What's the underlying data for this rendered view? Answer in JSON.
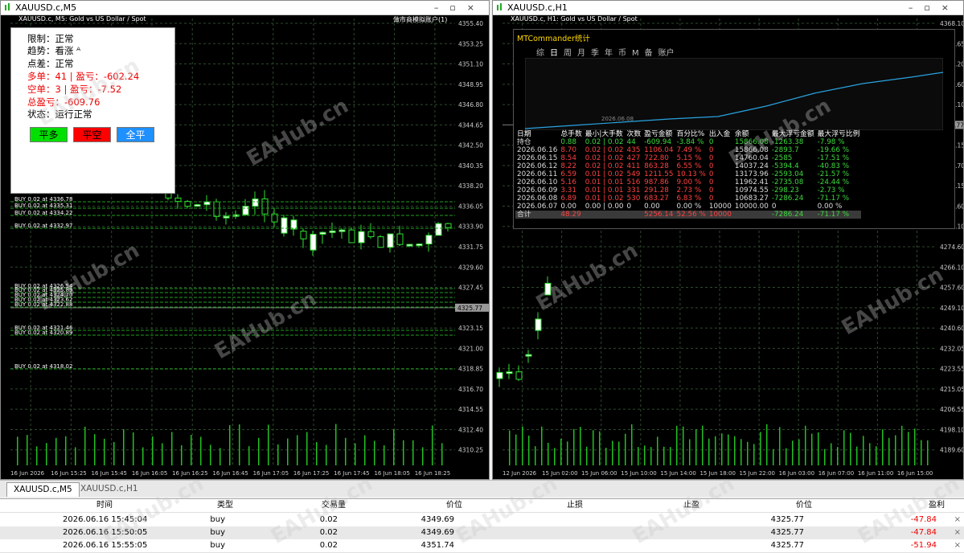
{
  "left_window": {
    "title": "XAUUSD.c,M5",
    "subtitle": "XAUUSD.c, M5: Gold vs US Dollar / Spot",
    "top_right": "做市商模拟账户(1)",
    "prices": [
      "4355.40",
      "4353.25",
      "4351.10",
      "4348.95",
      "4346.80",
      "4344.65",
      "4342.50",
      "4340.35",
      "4338.20",
      "4336.05",
      "4333.90",
      "4331.75",
      "4329.60",
      "4327.45",
      "4325.30",
      "4323.15",
      "4321.00",
      "4318.85",
      "4316.70",
      "4314.55",
      "4312.40",
      "4310.25"
    ],
    "current_price": "4325.77",
    "times": [
      "16 Jun 2026",
      "16 Jun 15:25",
      "16 Jun 15:45",
      "16 Jun 16:05",
      "16 Jun 16:25",
      "16 Jun 16:45",
      "16 Jun 17:05",
      "16 Jun 17:25",
      "16 Jun 17:45",
      "16 Jun 18:05",
      "16 Jun 18:25"
    ],
    "buy_labels": [
      "BUY 0.02 at 4336.78",
      "BUY 0.02 at 4335.31",
      "BUY 0.02 at 4334.22",
      "BUY 0.02 at 4332.97",
      "BUY 0.02 at 4326.54",
      "BUY 0.02 at 4325.89",
      "BUY 0.02 at 4324.70",
      "BUY 0.02 at 4323.62",
      "BUY 0.02 at 4322.88",
      "BUY 0.02 at 4321.46",
      "BUY 0.02 at 4320.89",
      "BUY 0.02 at 4318.02"
    ]
  },
  "right_window": {
    "title": "XAUUSD.c,H1",
    "subtitle": "XAUUSD.c, H1: Gold vs US Dollar / Spot",
    "prices": [
      "4368.10",
      "4359.65",
      "4351.20",
      "4342.60",
      "4334.10",
      "4325.77",
      "4317.15",
      "4308.70",
      "4300.15",
      "4291.60",
      "4283.10",
      "4274.60",
      "4266.10",
      "4257.60",
      "4249.10",
      "4240.60",
      "4232.05",
      "4223.55",
      "4215.05",
      "4206.55",
      "4198.10",
      "4189.60"
    ],
    "times": [
      "12 Jun 2026",
      "15 Jun 02:00",
      "15 Jun 06:00",
      "15 Jun 10:00",
      "15 Jun 14:00",
      "15 Jun 18:00",
      "15 Jun 22:00",
      "16 Jun 03:00",
      "16 Jun 07:00",
      "16 Jun 11:00",
      "16 Jun 15:00"
    ]
  },
  "panel": {
    "limit": "限制：正常",
    "trend": "趋势：看涨 ᴬ",
    "spread": "点差：正常",
    "long": "多单：41 | 盈亏：-602.24",
    "short": "空单：3 | 盈亏：-7.52",
    "total": "总盈亏：-609.76",
    "status": "状态：运行正常",
    "btn_long": "平多",
    "btn_short": "平空",
    "btn_all": "全平"
  },
  "stats": {
    "title": "MTCommander统计",
    "tabs": [
      "综",
      "日",
      "周",
      "月",
      "季",
      "年",
      "币",
      "M",
      "备",
      "账户"
    ],
    "curve_label": "2026.06.08",
    "headers": [
      "日期",
      "总手数",
      "最小|大手数",
      "次数",
      "盈亏金额",
      "百分比%",
      "出入金",
      "余额",
      "最大浮亏金额",
      "最大浮亏比例"
    ],
    "rows": [
      [
        "持仓",
        "0.88",
        "0.02 | 0.02",
        "44",
        "-609.94",
        "-3.84 %",
        "0",
        "15866.08",
        "-1263.38",
        "-7.98 %"
      ],
      [
        "2026.06.16",
        "8.70",
        "0.02 | 0.02",
        "435",
        "1106.04",
        "7.49 %",
        "0",
        "15866.08",
        "-2893.7",
        "-19.66 %"
      ],
      [
        "2026.06.15",
        "8.54",
        "0.02 | 0.02",
        "427",
        "722.80",
        "5.15 %",
        "0",
        "14760.04",
        "-2585",
        "-17.51 %"
      ],
      [
        "2026.06.12",
        "8.22",
        "0.02 | 0.02",
        "411",
        "863.28",
        "6.55 %",
        "0",
        "14037.24",
        "-5394.4",
        "-40.83 %"
      ],
      [
        "2026.06.11",
        "6.59",
        "0.01 | 0.02",
        "549",
        "1211.55",
        "10.13 %",
        "0",
        "13173.96",
        "-2593.04",
        "-21.57 %"
      ],
      [
        "2026.06.10",
        "5.16",
        "0.01 | 0.01",
        "516",
        "987.86",
        "9.00 %",
        "0",
        "11962.41",
        "-2735.08",
        "-24.44 %"
      ],
      [
        "2026.06.09",
        "3.31",
        "0.01 | 0.01",
        "331",
        "291.28",
        "2.73 %",
        "0",
        "10974.55",
        "-298.23",
        "-2.73 %"
      ],
      [
        "2026.06.08",
        "6.89",
        "0.01 | 0.02",
        "530",
        "683.27",
        "6.83 %",
        "0",
        "10683.27",
        "-7286.24",
        "-71.17 %"
      ],
      [
        "2026.06.07",
        "0.00",
        "0.00 | 0.00",
        "0",
        "0.00",
        "0.00 %",
        "10000",
        "10000.00",
        "0",
        "0.00 %"
      ],
      [
        "合计",
        "48.29",
        "",
        "",
        "5256.14",
        "52.56 %",
        "10000",
        "",
        "-7286.24",
        "-71.17 %"
      ]
    ]
  },
  "tabs": [
    "XAUUSD.c,M5",
    "XAUUSD.c,H1"
  ],
  "terminal": {
    "headers": [
      "时间",
      "类型",
      "交易量",
      "价位",
      "止损",
      "止盈",
      "价位",
      "盈利"
    ],
    "rows": [
      [
        "2026.06.16 15:45:04",
        "buy",
        "0.02",
        "4349.69",
        "",
        "",
        "4325.77",
        "-47.84"
      ],
      [
        "2026.06.16 15:50:05",
        "buy",
        "0.02",
        "4349.69",
        "",
        "",
        "4325.77",
        "-47.84"
      ],
      [
        "2026.06.16 15:55:05",
        "buy",
        "0.02",
        "4351.74",
        "",
        "",
        "4325.77",
        "-51.94"
      ]
    ]
  },
  "watermark": "EAHub.cn"
}
